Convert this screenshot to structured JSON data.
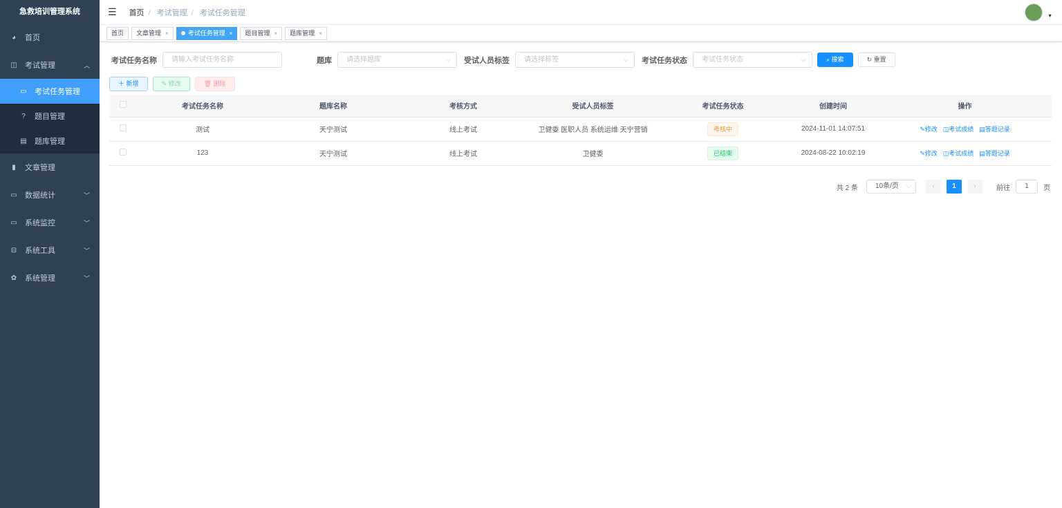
{
  "app_title": "急救培训管理系统",
  "sidebar": {
    "items": [
      {
        "label": "首页",
        "icon": "dashboard-icon"
      },
      {
        "label": "考试管理",
        "icon": "book-icon",
        "children": [
          {
            "label": "考试任务管理"
          },
          {
            "label": "题目管理"
          },
          {
            "label": "题库管理"
          }
        ]
      },
      {
        "label": "文章管理",
        "icon": "article-icon"
      },
      {
        "label": "数据统计",
        "icon": "monitor-icon"
      },
      {
        "label": "系统监控",
        "icon": "monitor-icon"
      },
      {
        "label": "系统工具",
        "icon": "toolbox-icon"
      },
      {
        "label": "系统管理",
        "icon": "gear-icon"
      }
    ]
  },
  "breadcrumb": [
    "首页",
    "考试管理",
    "考试任务管理"
  ],
  "tags": [
    "首页",
    "文章管理",
    "考试任务管理",
    "题目管理",
    "题库管理"
  ],
  "search": {
    "name_label": "考试任务名称",
    "name_placeholder": "请输入考试任务名称",
    "bank_label": "题库",
    "bank_placeholder": "请选择题库",
    "tag_label": "受试人员标签",
    "tag_placeholder": "请选择标签",
    "status_label": "考试任务状态",
    "status_placeholder": "考试任务状态",
    "search_btn": "搜索",
    "reset_btn": "重置"
  },
  "toolbar": {
    "add": "新增",
    "edit": "修改",
    "delete": "删除"
  },
  "table": {
    "headers": [
      "考试任务名称",
      "题库名称",
      "考核方式",
      "受试人员标签",
      "考试任务状态",
      "创建时间",
      "操作"
    ],
    "rows": [
      {
        "name": "测试",
        "bank": "天宁测试",
        "method": "线上考试",
        "tags": "卫健委 医职人员 系统运维 天宁营销",
        "status": "考核中",
        "created": "2024-11-01 14:07:51"
      },
      {
        "name": "123",
        "bank": "天宁测试",
        "method": "线上考试",
        "tags": "卫健委",
        "status": "已结束",
        "created": "2024-08-22 10:02:19"
      }
    ],
    "ops": [
      "修改",
      "考试成绩",
      "答题记录"
    ]
  },
  "pagination": {
    "total": "共 2 条",
    "page_size": "10条/页",
    "current": "1",
    "goto_label": "前往",
    "goto_value": "1",
    "page_suffix": "页"
  }
}
